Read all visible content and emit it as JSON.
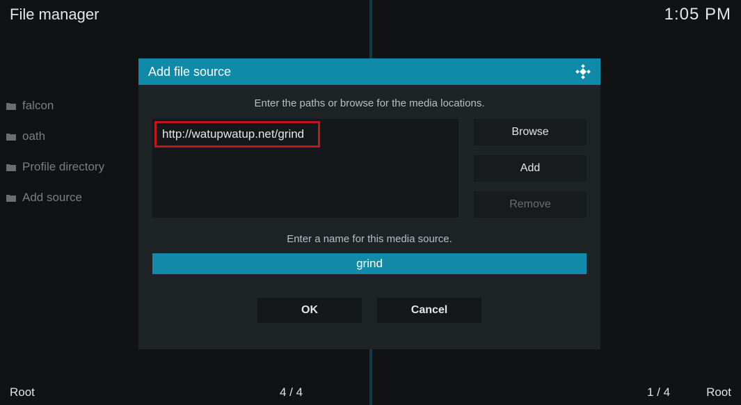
{
  "header": {
    "title": "File manager",
    "time": "1:05 PM"
  },
  "left_panel": {
    "items": [
      {
        "label": "falcon",
        "icon": "folder-icon"
      },
      {
        "label": "oath",
        "icon": "folder-icon"
      },
      {
        "label": "Profile directory",
        "icon": "folder-icon"
      },
      {
        "label": "Add source",
        "icon": "folder-icon"
      }
    ]
  },
  "footer": {
    "left_root": "Root",
    "left_count": "4 / 4",
    "right_count": "1 / 4",
    "right_root": "Root"
  },
  "dialog": {
    "title": "Add file source",
    "hint_paths": "Enter the paths or browse for the media locations.",
    "path_value": "http://watupwatup.net/grind",
    "browse_label": "Browse",
    "add_label": "Add",
    "remove_label": "Remove",
    "hint_name": "Enter a name for this media source.",
    "name_value": "grind",
    "ok_label": "OK",
    "cancel_label": "Cancel"
  }
}
